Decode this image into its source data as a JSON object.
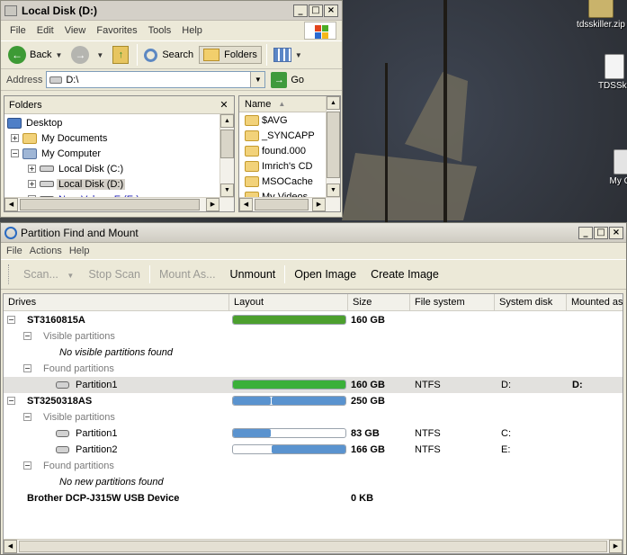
{
  "desktop": {
    "icons": [
      {
        "label": "tdsskiller.zip",
        "color": "#c9b36b"
      },
      {
        "label": "TDSSkil",
        "color": "#e8e8e8"
      },
      {
        "label": "My Co",
        "color": "#d9d9d9"
      }
    ]
  },
  "explorer": {
    "title": "Local Disk (D:)",
    "menu": [
      "File",
      "Edit",
      "View",
      "Favorites",
      "Tools",
      "Help"
    ],
    "toolbar": {
      "back": "Back",
      "search": "Search",
      "folders": "Folders"
    },
    "address": {
      "label": "Address",
      "value": "D:\\",
      "go": "Go"
    },
    "folders_pane": {
      "title": "Folders",
      "tree": [
        {
          "label": "Desktop",
          "icon": "desktop-icon",
          "expander": ""
        },
        {
          "label": "My Documents",
          "icon": "folder-icon",
          "expander": "+"
        },
        {
          "label": "My Computer",
          "icon": "computer-icon",
          "expander": "−"
        },
        {
          "label": "Local Disk (C:)",
          "icon": "drive-icon",
          "expander": "+"
        },
        {
          "label": "Local Disk (D:)",
          "icon": "drive-icon",
          "expander": "+",
          "selected": true
        },
        {
          "label": "New VolumeE (E:)",
          "icon": "drive-icon",
          "expander": "+"
        }
      ]
    },
    "list_pane": {
      "column": "Name",
      "items": [
        "$AVG",
        "_SYNCAPP",
        "found.000",
        "Imrich's CD",
        "MSOCache",
        "My Videos"
      ]
    }
  },
  "pfm": {
    "title": "Partition Find and Mount",
    "menu": [
      "File",
      "Actions",
      "Help"
    ],
    "toolbar": {
      "scan": "Scan...",
      "stop_scan": "Stop Scan",
      "mount_as": "Mount As...",
      "unmount": "Unmount",
      "open_image": "Open Image",
      "create_image": "Create Image"
    },
    "columns": {
      "drives": "Drives",
      "layout": "Layout",
      "size": "Size",
      "file_system": "File system",
      "system_disk": "System disk",
      "mounted_as": "Mounted as"
    },
    "rows": [
      {
        "level": 0,
        "expander": "−",
        "name": "ST3160815A",
        "size": "160 GB",
        "bold": true,
        "bar": {
          "segments": [
            {
              "start": 0.0,
              "end": 1.0
            }
          ],
          "color": "#4c9f2e",
          "bg": "#d6ebcc"
        }
      },
      {
        "level": 1,
        "expander": "−",
        "name": "Visible partitions",
        "grey": true
      },
      {
        "level": 2,
        "name": "No visible partitions found",
        "italic": true
      },
      {
        "level": 1,
        "expander": "−",
        "name": "Found partitions",
        "grey": true
      },
      {
        "level": 2,
        "disk": true,
        "name": "Partition1",
        "selected": true,
        "size": "160 GB",
        "fs": "NTFS",
        "sys": "D:",
        "mounted": "D:",
        "bar": {
          "segments": [
            {
              "start": 0.0,
              "end": 1.0
            }
          ],
          "color": "#3ab03a"
        }
      },
      {
        "level": 0,
        "expander": "−",
        "name": "ST3250318AS",
        "size": "250 GB",
        "bold": true,
        "bar": {
          "segments": [
            {
              "start": 0.0,
              "end": 0.33
            },
            {
              "start": 0.335,
              "end": 1.0
            }
          ],
          "color": "#5a93cf"
        }
      },
      {
        "level": 1,
        "expander": "−",
        "name": "Visible partitions",
        "grey": true
      },
      {
        "level": 2,
        "disk": true,
        "name": "Partition1",
        "size": "83 GB",
        "fs": "NTFS",
        "sys": "C:",
        "bar": {
          "segments": [
            {
              "start": 0.0,
              "end": 0.33
            }
          ],
          "color": "#5a93cf"
        }
      },
      {
        "level": 2,
        "disk": true,
        "name": "Partition2",
        "size": "166 GB",
        "fs": "NTFS",
        "sys": "E:",
        "bar": {
          "segments": [
            {
              "start": 0.335,
              "end": 1.0
            }
          ],
          "color": "#5a93cf"
        }
      },
      {
        "level": 1,
        "expander": "−",
        "name": "Found partitions",
        "grey": true
      },
      {
        "level": 2,
        "name": "No new partitions found",
        "italic": true
      },
      {
        "level": 0,
        "name": "Brother DCP-J315W USB Device",
        "size": "0 KB",
        "bold": true
      }
    ]
  }
}
